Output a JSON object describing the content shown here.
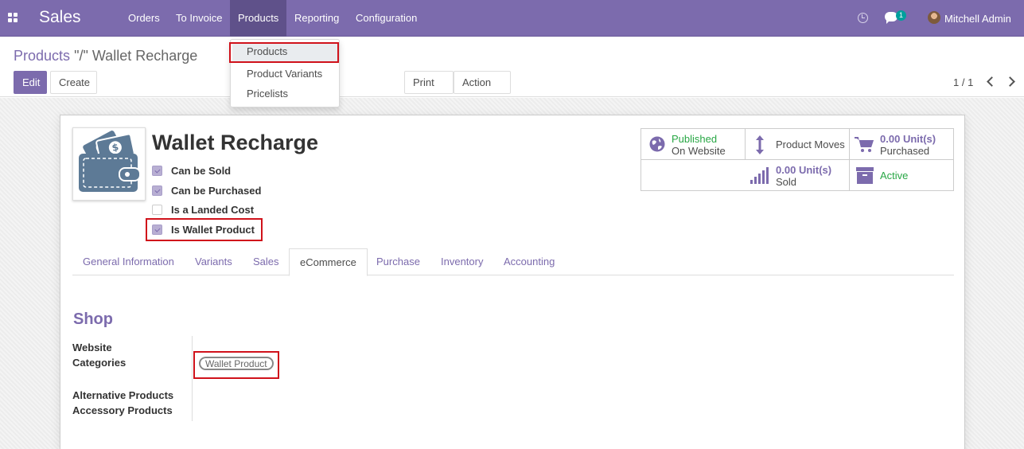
{
  "navbar": {
    "brand": "Sales",
    "menus": [
      "Orders",
      "To Invoice",
      "Products",
      "Reporting",
      "Configuration"
    ],
    "notifications": "1",
    "user": "Mitchell Admin"
  },
  "products_menu": [
    "Products",
    "Product Variants",
    "Pricelists"
  ],
  "breadcrumb": {
    "parent": "Products",
    "separator": "\"/\"",
    "current": "Wallet Recharge"
  },
  "buttons": {
    "edit": "Edit",
    "create": "Create",
    "print": "Print",
    "action": "Action"
  },
  "pager": "1 / 1",
  "product": {
    "name": "Wallet Recharge",
    "checkboxes": [
      {
        "label": "Can be Sold",
        "checked": true
      },
      {
        "label": "Can be Purchased",
        "checked": true
      },
      {
        "label": "Is a Landed Cost",
        "checked": false
      },
      {
        "label": "Is Wallet Product",
        "checked": true
      }
    ]
  },
  "smart_buttons": {
    "published": "Published",
    "on_website": "On Website",
    "moves": "Product Moves",
    "purchased_value": "0.00",
    "purchased_unit": "Unit(s)",
    "purchased_label": "Purchased",
    "sold_value": "0.00",
    "sold_unit": "Unit(s)",
    "sold_label": "Sold",
    "active": "Active"
  },
  "tabs": [
    "General Information",
    "Variants",
    "Sales",
    "eCommerce",
    "Purchase",
    "Inventory",
    "Accounting"
  ],
  "active_tab": "eCommerce",
  "shop": {
    "title": "Shop",
    "website_label": "Website",
    "categories_label": "Categories",
    "category_tag": "Wallet Product",
    "alternative": "Alternative Products",
    "accessory": "Accessory Products"
  },
  "colors": {
    "brand": "#7c6bad",
    "highlight": "#d0121b",
    "published": "#28a745"
  }
}
